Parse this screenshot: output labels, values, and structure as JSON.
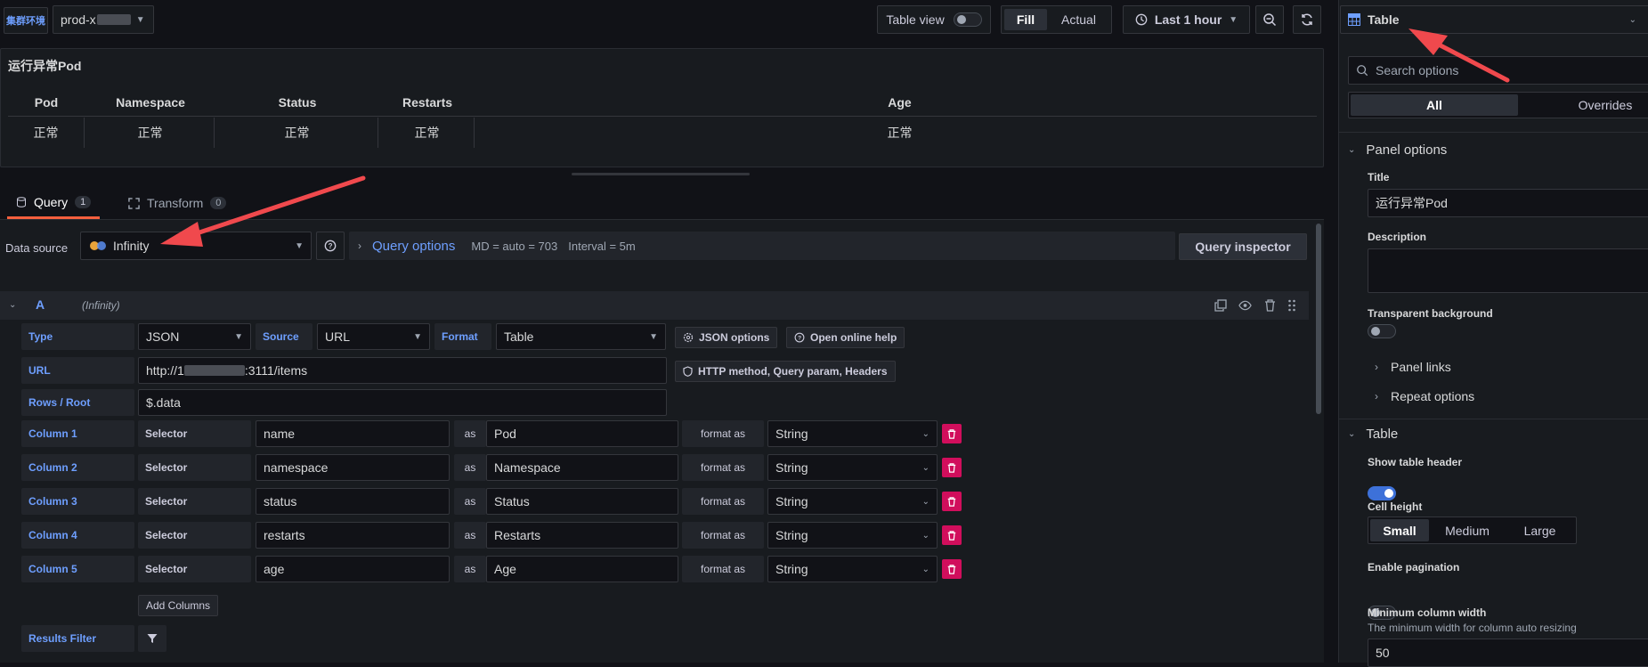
{
  "topbar": {
    "env_label": "集群环境",
    "env_value": "prod-x",
    "table_view": "Table view",
    "fill": "Fill",
    "actual": "Actual",
    "time_range": "Last 1 hour"
  },
  "panel": {
    "title": "运行异常Pod",
    "columns": [
      "Pod",
      "Namespace",
      "Status",
      "Restarts",
      "Age"
    ],
    "row": [
      "正常",
      "正常",
      "正常",
      "正常",
      "正常"
    ]
  },
  "tabs": {
    "query": "Query",
    "query_count": "1",
    "transform": "Transform",
    "transform_count": "0"
  },
  "datasource": {
    "label": "Data source",
    "value": "Infinity",
    "query_options": "Query options",
    "md": "MD = auto = 703",
    "interval": "Interval = 5m",
    "inspector": "Query inspector"
  },
  "query": {
    "ref": "A",
    "ds": "(Infinity)",
    "type_label": "Type",
    "type_value": "JSON",
    "source_label": "Source",
    "source_value": "URL",
    "format_label": "Format",
    "format_value": "Table",
    "json_options": "JSON options",
    "online_help": "Open online help",
    "url_label": "URL",
    "url_prefix": "http://1",
    "url_suffix": ":3111/items",
    "http_btn": "HTTP method, Query param, Headers",
    "rows_label": "Rows / Root",
    "rows_value": "$.data",
    "selector_label": "Selector",
    "as_label": "as",
    "format_as_label": "format as",
    "columns": [
      {
        "label": "Column 1",
        "selector": "name",
        "alias": "Pod",
        "format": "String"
      },
      {
        "label": "Column 2",
        "selector": "namespace",
        "alias": "Namespace",
        "format": "String"
      },
      {
        "label": "Column 3",
        "selector": "status",
        "alias": "Status",
        "format": "String"
      },
      {
        "label": "Column 4",
        "selector": "restarts",
        "alias": "Restarts",
        "format": "String"
      },
      {
        "label": "Column 5",
        "selector": "age",
        "alias": "Age",
        "format": "String"
      }
    ],
    "add_columns": "Add Columns",
    "results_filter": "Results Filter"
  },
  "options": {
    "viz": "Table",
    "search_placeholder": "Search options",
    "tab_all": "All",
    "tab_overrides": "Overrides",
    "panel_options": "Panel options",
    "title_label": "Title",
    "title_value": "运行异常Pod",
    "description_label": "Description",
    "transparent_label": "Transparent background",
    "panel_links": "Panel links",
    "repeat_options": "Repeat options",
    "table_section": "Table",
    "show_header": "Show table header",
    "cell_height": "Cell height",
    "cell_small": "Small",
    "cell_medium": "Medium",
    "cell_large": "Large",
    "pagination": "Enable pagination",
    "min_col_width": "Minimum column width",
    "min_col_desc": "The minimum width for column auto resizing",
    "min_col_value": "50"
  },
  "colors": {
    "bg": "#111217",
    "panel": "#181b1f",
    "accent": "#6e9fff",
    "danger": "#d10e5c",
    "annotation": "#f0494d"
  }
}
